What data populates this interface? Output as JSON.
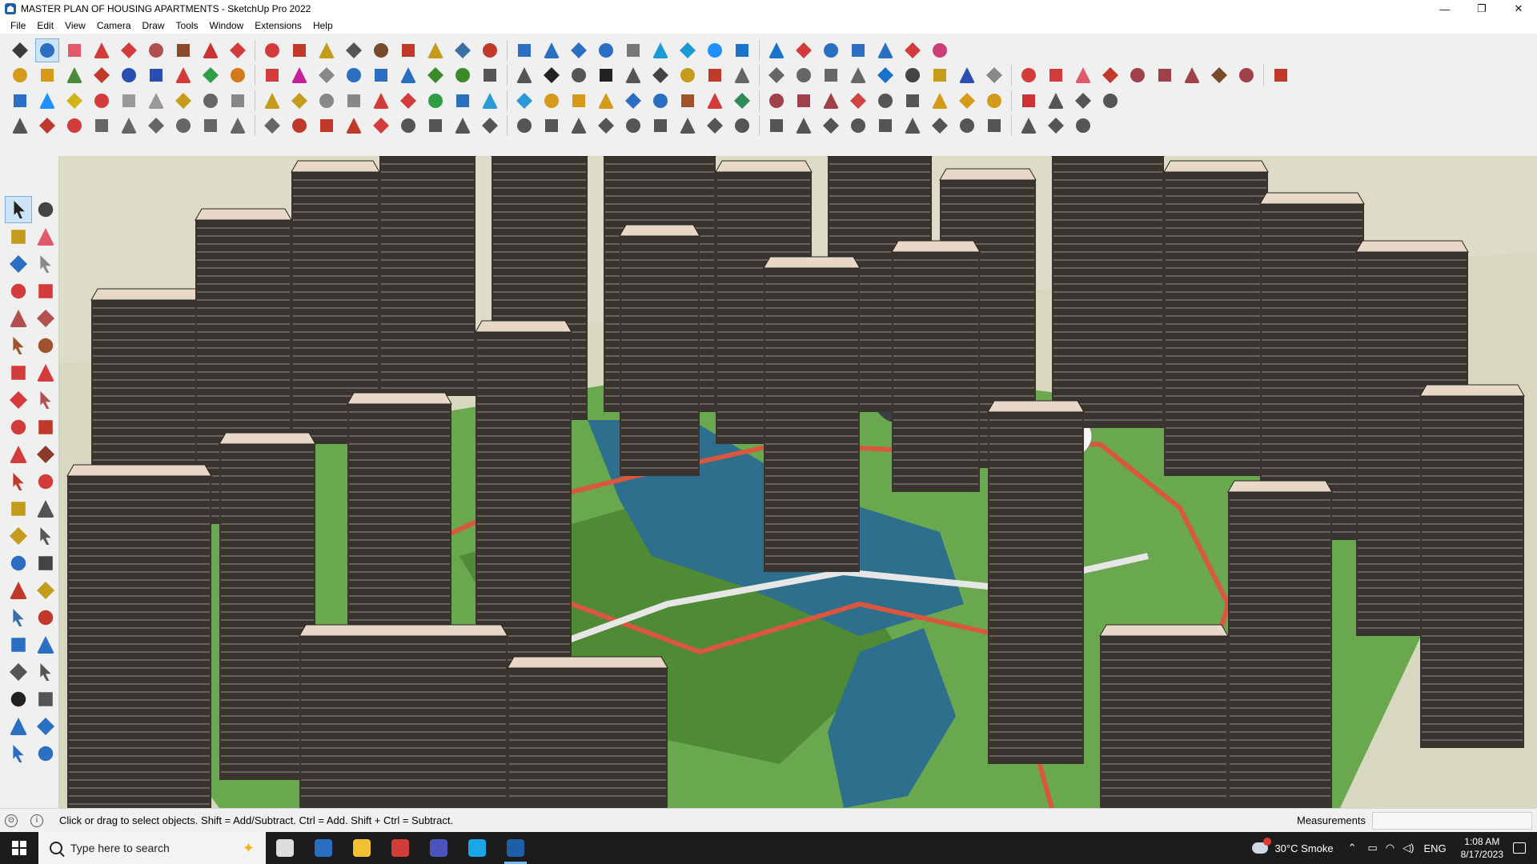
{
  "window": {
    "title": "MASTER PLAN OF HOUSING APARTMENTS - SketchUp Pro 2022",
    "controls": {
      "minimize": "—",
      "restore": "❐",
      "close": "✕"
    }
  },
  "menu": [
    "File",
    "Edit",
    "View",
    "Camera",
    "Draw",
    "Tools",
    "Window",
    "Extensions",
    "Help"
  ],
  "toolbar_rows": [
    {
      "icons": [
        "search-icon",
        "select-arrow-icon",
        "eraser-icon",
        "pencil-line-icon",
        "arc-icon",
        "rectangle-icon",
        "push-pull-icon",
        "follow-me-icon",
        "move-icon",
        "rotate-icon",
        "scale-icon",
        "tape-measure-icon",
        "text-icon",
        "paint-bucket-icon",
        "orbit-icon",
        "pan-icon",
        "zoom-icon",
        "zoom-extents-icon",
        "styles-icon",
        "layers-icon",
        "shadows-icon",
        "sections-icon",
        "camera-icon",
        "components-icon",
        "materials-icon",
        "scenes-icon",
        "outliner-icon",
        "sort-up-icon",
        "sort-down-icon",
        "dimension-icon",
        "axes-icon",
        "undo-icon",
        "redo-icon",
        "extension-warehouse-icon"
      ],
      "colors": [
        "#3a3a3a",
        "#2a6fc2",
        "#e05a6a",
        "#d43c3c",
        "#d43c3c",
        "#b05050",
        "#8a4a2a",
        "#cc3333",
        "#d43c3c",
        "#d43c3c",
        "#c0392b",
        "#c49b1a",
        "#555",
        "#7a4b2a",
        "#c0392b",
        "#c49b1a",
        "#3a6ea5",
        "#c0392b",
        "#2a6fc2",
        "#2a6fc2",
        "#2a6fc2",
        "#2a6fc2",
        "#777",
        "#1a9ad6",
        "#1a9ad6",
        "#1e90ff",
        "#1a73c8",
        "#1a73c8",
        "#d43c3c",
        "#2a6fc2",
        "#2a6fc2",
        "#2a6fc2",
        "#d43c3c",
        "#cc3d7a"
      ]
    },
    {
      "icons": [
        "iso-view-icon",
        "top-view-icon",
        "front-view-icon",
        "intersect-icon",
        "push-down-icon",
        "push-right-icon",
        "push-left-icon",
        "push-up-icon",
        "push-n-icon",
        "push-x-icon",
        "push-f-icon",
        "sandbox-icon",
        "section-plane-icon",
        "section-cut-icon",
        "section-fill-icon",
        "terrain-icon",
        "grid-icon",
        "house-1-icon",
        "house-2-icon",
        "house-3-icon",
        "house-4-icon",
        "house-5-icon",
        "house-6-icon",
        "function-icon",
        "stamp-icon",
        "draw-red-icon",
        "shape-1-icon",
        "shape-2-icon",
        "shape-3-icon",
        "shape-4-icon",
        "shape-5-icon",
        "curve-icon",
        "shape-6-icon",
        "shape-7-icon",
        "shape-8-icon",
        "shape-9-icon",
        "shape-10-icon",
        "spline-icon",
        "brush-icon",
        "profile-icon",
        "flatten-icon",
        "material-a-icon",
        "material-b-icon",
        "material-c-icon",
        "material-d-icon",
        "material-e-icon"
      ],
      "colors": [
        "#d49a1a",
        "#d49a1a",
        "#4a8a3a",
        "#c0392b",
        "#2a4fb0",
        "#2a4fb0",
        "#d43c3c",
        "#2ea043",
        "#d47a1a",
        "#d43c3c",
        "#c61f9a",
        "#888",
        "#2a6fc2",
        "#2a6fc2",
        "#2a6fc2",
        "#3a8a2a",
        "#3a8a2a",
        "#555",
        "#555",
        "#222",
        "#555",
        "#222",
        "#555",
        "#444",
        "#c49b1a",
        "#c0392b",
        "#666",
        "#666",
        "#666",
        "#666",
        "#666",
        "#1a73c8",
        "#444",
        "#c49b1a",
        "#2a4fb0",
        "#888",
        "#d43c3c",
        "#d43c3c",
        "#e05a6a",
        "#c0392b",
        "#a0404a",
        "#a0404a",
        "#a0404a",
        "#7a4b2a",
        "#a0404a",
        "#c0392b"
      ]
    },
    {
      "icons": [
        "solid-a-icon",
        "solid-b-icon",
        "solid-c-icon",
        "color-picker-icon",
        "tools-d-icon",
        "eraser-b-icon",
        "bucket-b-icon",
        "offset-icon",
        "window-icon",
        "door-icon",
        "wall-icon",
        "tool-k-icon",
        "tool-l-icon",
        "chain-icon",
        "cross-red-icon",
        "cross-green-icon",
        "cross-blue-icon",
        "cone-icon",
        "roof-icon",
        "warning-icon",
        "arc-yellow-icon",
        "arc-orange-icon",
        "arc-blue-icon",
        "move-blue-icon",
        "tool-r-icon",
        "tool-s-icon",
        "tool-t-icon",
        "tool-u-icon",
        "tool-v-icon",
        "tool-w-icon",
        "tool-x-icon",
        "tool-y-icon",
        "tool-z-icon",
        "tool-aa-icon",
        "tool-ab-icon",
        "tool-ac-icon",
        "tool-ad-icon",
        "tool-ae-icon",
        "tool-af-icon",
        "tool-ag-icon"
      ],
      "colors": [
        "#2a6fc2",
        "#1e90ff",
        "#d4b21a",
        "#d43c3c",
        "#999",
        "#999",
        "#c49b1a",
        "#666",
        "#888",
        "#c49b1a",
        "#c49b1a",
        "#888",
        "#888",
        "#d43c3c",
        "#d43c3c",
        "#2ea043",
        "#2a6fc2",
        "#2a9ad6",
        "#2a9ad6",
        "#d49a1a",
        "#d49a1a",
        "#d49a1a",
        "#2a6fc2",
        "#2a6fc2",
        "#a0522d",
        "#d43c3c",
        "#2e8b57",
        "#a0404a",
        "#a0404a",
        "#a0404a",
        "#c44",
        "#555",
        "#555",
        "#d49a1a",
        "#d49a1a",
        "#d49a1a",
        "#c33",
        "#555",
        "#555",
        "#555"
      ]
    },
    {
      "icons": [
        "polygon-a-icon",
        "line-a-icon",
        "car-icon",
        "tool-4a-icon",
        "tool-4b-icon",
        "tool-4c-icon",
        "tool-4d-icon",
        "tool-4e-icon",
        "tool-4f-icon",
        "tool-4g-icon",
        "tool-4h-icon",
        "tool-4i-icon",
        "tool-4j-icon",
        "tool-4k-icon",
        "tool-4l-icon",
        "tool-4m-icon",
        "tool-4n-icon",
        "tool-4o-icon",
        "tool-4p-icon",
        "tool-4q-icon",
        "tool-4r-icon",
        "tool-4s-icon",
        "tool-4t-icon",
        "tool-4u-icon",
        "tool-4v-icon",
        "tool-4w-icon",
        "tool-4x-icon",
        "tool-4y-icon",
        "tool-4z-icon",
        "tool-5a-icon",
        "tool-5b-icon",
        "tool-5c-icon",
        "tool-5d-icon",
        "tool-5e-icon",
        "tool-5f-icon",
        "tool-5g-icon",
        "tool-5h-icon",
        "tool-5i-icon",
        "tool-5j-icon"
      ],
      "colors": [
        "#555",
        "#c0392b",
        "#d43c3c",
        "#666",
        "#666",
        "#666",
        "#666",
        "#666",
        "#666",
        "#666",
        "#c0392b",
        "#c0392b",
        "#c0392b",
        "#d43c3c",
        "#555",
        "#555",
        "#555",
        "#555",
        "#555",
        "#555",
        "#555",
        "#555",
        "#555",
        "#555",
        "#555",
        "#555",
        "#555",
        "#555",
        "#555",
        "#555",
        "#555",
        "#555",
        "#555",
        "#555",
        "#555",
        "#555",
        "#555",
        "#555",
        "#555"
      ]
    }
  ],
  "left_tools": [
    {
      "name": "select-tool-icon",
      "color": "#222",
      "selected": true
    },
    {
      "name": "orbit-tool-icon",
      "color": "#444"
    },
    {
      "name": "paint-tool-icon",
      "color": "#c49b1a"
    },
    {
      "name": "eraser-tool-icon",
      "color": "#e05a6a"
    },
    {
      "name": "component-tool-icon",
      "color": "#2a6fc2"
    },
    {
      "name": "pencil-tool-icon",
      "color": "#888"
    },
    {
      "name": "line-tool-icon",
      "color": "#d43c3c"
    },
    {
      "name": "freehand-tool-icon",
      "color": "#d43c3c"
    },
    {
      "name": "rectangle-tool-icon",
      "color": "#b05050"
    },
    {
      "name": "rotated-rect-tool-icon",
      "color": "#b05050"
    },
    {
      "name": "circle-tool-icon",
      "color": "#a0522d"
    },
    {
      "name": "polygon-tool-icon",
      "color": "#a0522d"
    },
    {
      "name": "arc-tool-icon",
      "color": "#d43c3c"
    },
    {
      "name": "two-point-arc-tool-icon",
      "color": "#d43c3c"
    },
    {
      "name": "three-point-arc-tool-icon",
      "color": "#d43c3c"
    },
    {
      "name": "pie-tool-icon",
      "color": "#b05050"
    },
    {
      "name": "move-tool-icon",
      "color": "#d43c3c"
    },
    {
      "name": "push-pull-tool-icon",
      "color": "#c0392b"
    },
    {
      "name": "rotate-tool-icon",
      "color": "#d43c3c"
    },
    {
      "name": "follow-me-tool-icon",
      "color": "#8a3a2a"
    },
    {
      "name": "scale-tool-icon",
      "color": "#c0392b"
    },
    {
      "name": "offset-tool-icon",
      "color": "#d43c3c"
    },
    {
      "name": "tape-tool-icon",
      "color": "#c49b1a"
    },
    {
      "name": "dimension-tool-icon",
      "color": "#555"
    },
    {
      "name": "protractor-tool-icon",
      "color": "#c49b1a"
    },
    {
      "name": "text-tool-icon",
      "color": "#555"
    },
    {
      "name": "axes-tool-icon",
      "color": "#2a6fc2"
    },
    {
      "name": "3d-text-tool-icon",
      "color": "#444"
    },
    {
      "name": "orbit-nav-tool-icon",
      "color": "#c0392b"
    },
    {
      "name": "pan-tool-icon",
      "color": "#c49b1a"
    },
    {
      "name": "zoom-tool-icon",
      "color": "#3a6ea5"
    },
    {
      "name": "zoom-window-tool-icon",
      "color": "#c0392b"
    },
    {
      "name": "zoom-extents-tool-icon",
      "color": "#2a6fc2"
    },
    {
      "name": "previous-view-tool-icon",
      "color": "#2a6fc2"
    },
    {
      "name": "position-camera-tool-icon",
      "color": "#555"
    },
    {
      "name": "look-around-tool-icon",
      "color": "#555"
    },
    {
      "name": "walk-tool-icon",
      "color": "#222"
    },
    {
      "name": "section-tool-icon",
      "color": "#555"
    },
    {
      "name": "styles-tool-icon",
      "color": "#2a6fc2"
    },
    {
      "name": "shadows-tool-icon",
      "color": "#2a6fc2"
    },
    {
      "name": "layers-tool-icon",
      "color": "#2a6fc2"
    },
    {
      "name": "fog-tool-icon",
      "color": "#2a6fc2"
    }
  ],
  "status": {
    "hint": "Click or drag to select objects. Shift = Add/Subtract. Ctrl = Add. Shift + Ctrl = Subtract.",
    "measurements_label": "Measurements",
    "measurements_value": ""
  },
  "taskbar": {
    "search_placeholder": "Type here to search",
    "apps": [
      "task-view-icon",
      "calculator-icon",
      "file-explorer-icon",
      "acrobat-icon",
      "teams-icon",
      "edge-icon",
      "sketchup-icon"
    ],
    "weather": "30°C  Smoke",
    "language": "ENG",
    "time": "1:08 AM",
    "date": "8/17/2023"
  },
  "scene": {
    "background": "#dcdcc8",
    "ground": "#d8d8c0",
    "lawn": "#6aa84f",
    "lawn_dark": "#4f8a35",
    "water": "#2e6f8e",
    "path_red": "#d9563f",
    "path_light": "#e6e6e6",
    "tower_face": "#3a3430",
    "tower_roof": "#e8d8c8"
  }
}
